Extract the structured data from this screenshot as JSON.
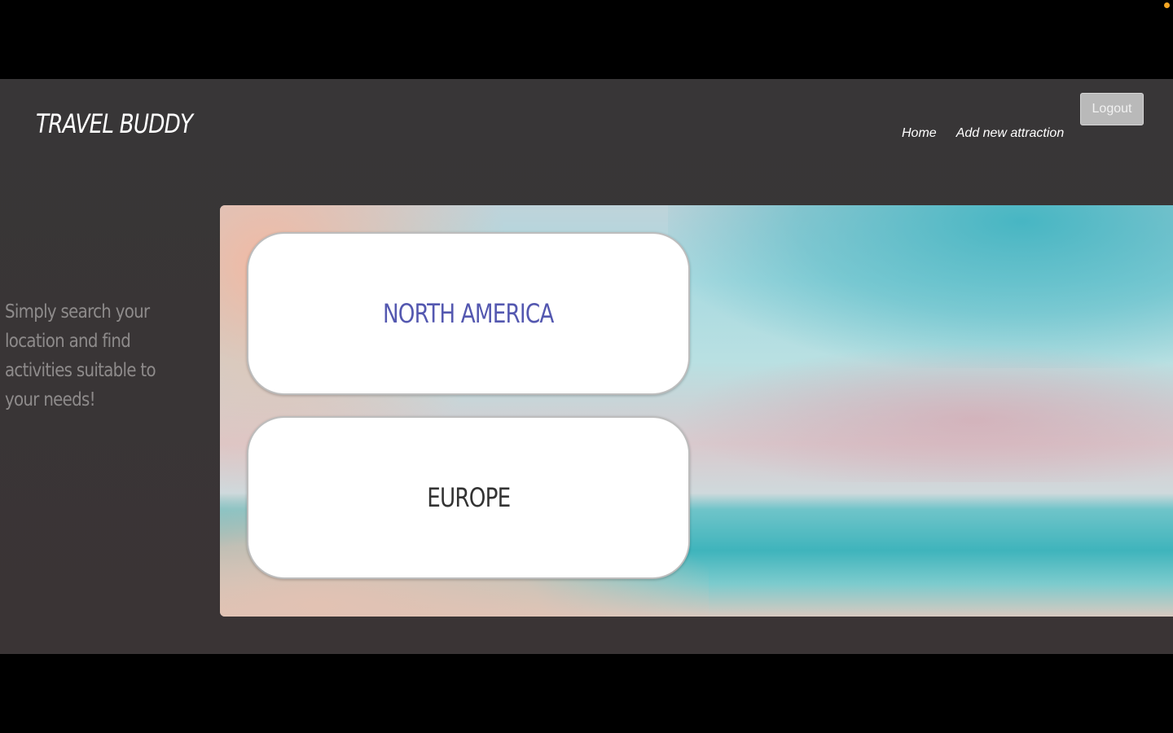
{
  "header": {
    "brand": "TRAVEL BUDDY",
    "nav": [
      {
        "label": "Home"
      },
      {
        "label": "Add new attraction"
      }
    ],
    "logout_label": "Logout"
  },
  "sidebar": {
    "tagline": "Simply search your location and find activities suitable to your needs!"
  },
  "regions": [
    {
      "label": "NORTH AMERICA",
      "color": "#5458b0"
    },
    {
      "label": "EUROPE",
      "color": "#333333"
    }
  ],
  "colors": {
    "background": "#383637",
    "card": "#ffffff",
    "logout_button": "#b9b9b9"
  }
}
